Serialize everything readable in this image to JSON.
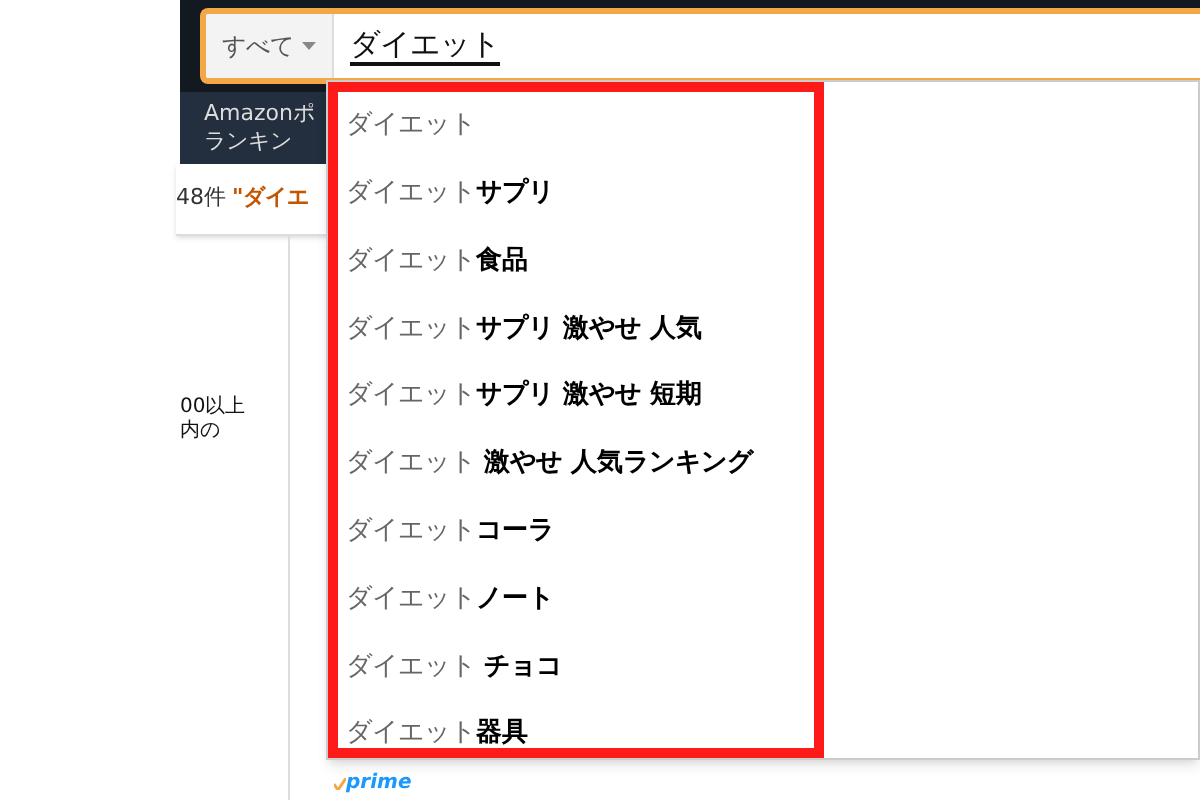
{
  "search": {
    "category": "すべて",
    "value": "ダイエット"
  },
  "nav": {
    "lines": [
      "Amazonポ",
      "ランキン"
    ]
  },
  "results": {
    "count": "48件",
    "query": "\"ダイエ"
  },
  "filter": {
    "lines": [
      "00以上",
      "内の"
    ]
  },
  "suggestions": [
    {
      "text": "ダイエット"
    },
    {
      "text": "ダイエット**サプリ**"
    },
    {
      "text": "ダイエット**食品**"
    },
    {
      "text": "ダイエット**サプリ 激やせ 人気**"
    },
    {
      "text": "ダイエット**サプリ 激やせ 短期**"
    },
    {
      "text": "ダイエット **激やせ 人気ランキング**"
    },
    {
      "text": "ダイエット**コーラ**"
    },
    {
      "text": "ダイエット**ノート**"
    },
    {
      "text": "ダイエット **チョコ**"
    },
    {
      "text": "ダイエット**器具**"
    }
  ],
  "highlight": {
    "color": "#ff1a1a"
  },
  "badge": "prime"
}
